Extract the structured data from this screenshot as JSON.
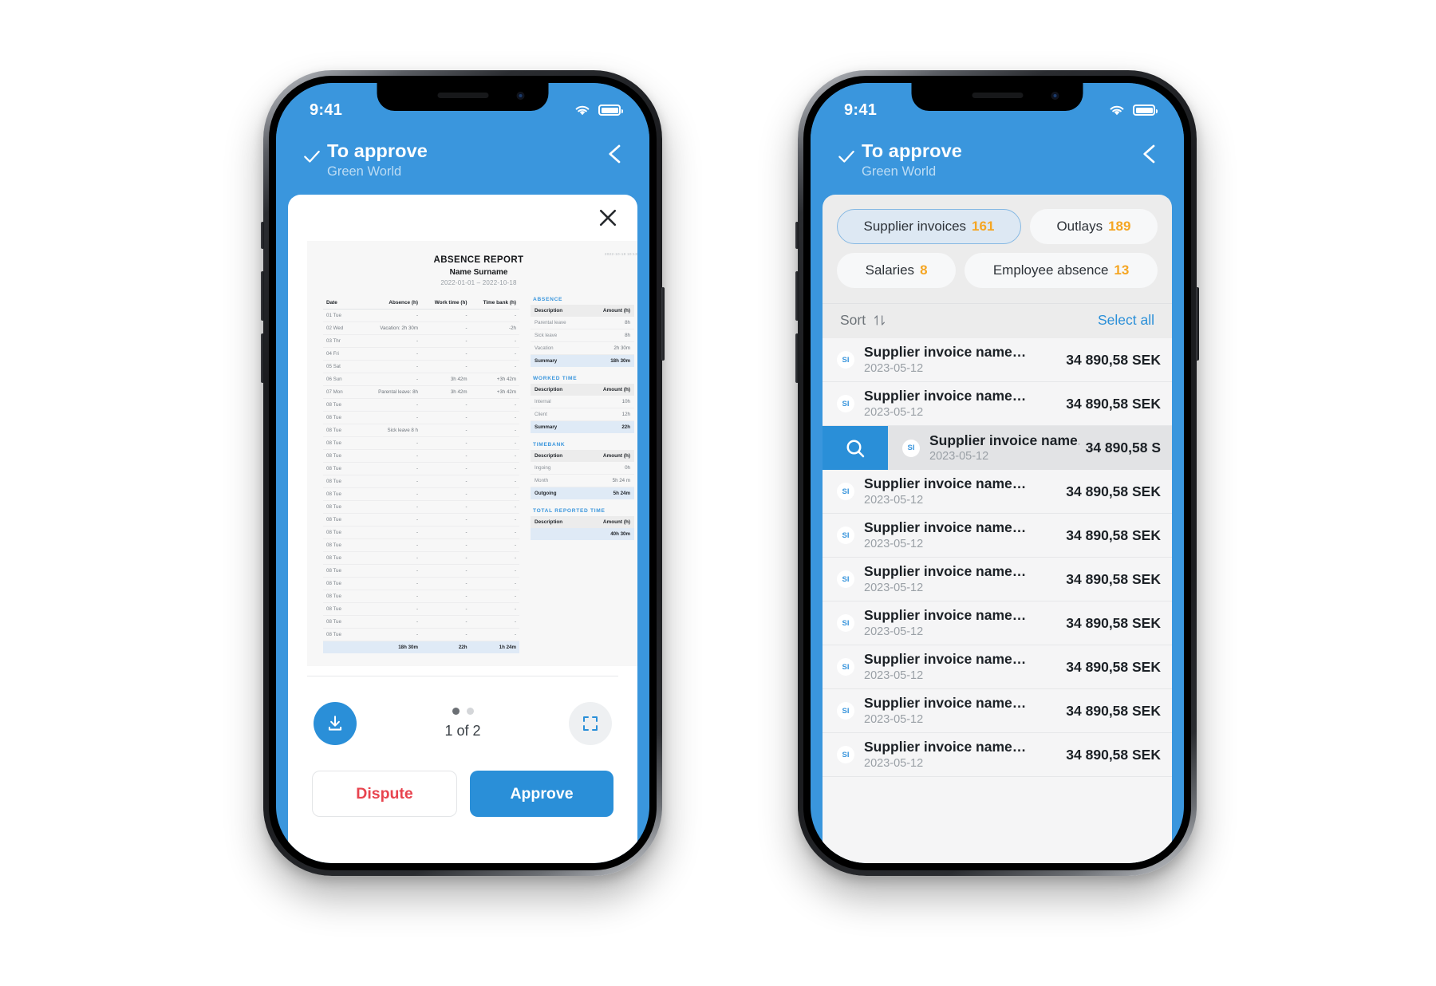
{
  "phones": {
    "left": {
      "status": {
        "time": "9:41",
        "wifi_icon": "wifi-icon",
        "battery_icon": "battery-icon"
      },
      "appbar": {
        "check_icon": "check-icon",
        "title": "To approve",
        "subtitle": "Green World",
        "back_icon": "chevron-left-icon"
      },
      "sheet": {
        "close_icon": "close-icon",
        "document": {
          "title": "ABSENCE REPORT",
          "person": "Name Surname",
          "date_range": "2022-01-01 – 2022-10-18",
          "corner_stamp": "2022-10-18 10:13",
          "main_table": {
            "headers": [
              "Date",
              "Absence (h)",
              "Work time (h)",
              "Time bank (h)"
            ],
            "rows": [
              [
                "01 Tue",
                "-",
                "-",
                "-"
              ],
              [
                "02 Wed",
                "Vacation: 2h 30m",
                "-",
                "-2h"
              ],
              [
                "03 Thr",
                "-",
                "-",
                "-"
              ],
              [
                "04 Fri",
                "-",
                "-",
                "-"
              ],
              [
                "05 Sat",
                "-",
                "-",
                "-"
              ],
              [
                "06 Sun",
                "-",
                "3h 42m",
                "+3h 42m"
              ],
              [
                "07 Mon",
                "Parental leave: 8h",
                "3h 42m",
                "+3h 42m"
              ],
              [
                "08 Tue",
                "-",
                "-",
                "-"
              ],
              [
                "08 Tue",
                "-",
                "-",
                "-"
              ],
              [
                "08 Tue",
                "Sick leave 8 h",
                "-",
                "-"
              ],
              [
                "08 Tue",
                "-",
                "-",
                "-"
              ],
              [
                "08 Tue",
                "-",
                "-",
                "-"
              ],
              [
                "08 Tue",
                "-",
                "-",
                "-"
              ],
              [
                "08 Tue",
                "-",
                "-",
                "-"
              ],
              [
                "08 Tue",
                "-",
                "-",
                "-"
              ],
              [
                "08 Tue",
                "-",
                "-",
                "-"
              ],
              [
                "08 Tue",
                "-",
                "-",
                "-"
              ],
              [
                "08 Tue",
                "-",
                "-",
                "-"
              ],
              [
                "08 Tue",
                "-",
                "-",
                "-"
              ],
              [
                "08 Tue",
                "-",
                "-",
                "-"
              ],
              [
                "08 Tue",
                "-",
                "-",
                "-"
              ],
              [
                "08 Tue",
                "-",
                "-",
                "-"
              ],
              [
                "08 Tue",
                "-",
                "-",
                "-"
              ],
              [
                "08 Tue",
                "-",
                "-",
                "-"
              ],
              [
                "08 Tue",
                "-",
                "-",
                "-"
              ],
              [
                "08 Tue",
                "-",
                "-",
                "-"
              ]
            ],
            "total_row": [
              "",
              "18h 30m",
              "22h",
              "1h 24m"
            ]
          },
          "sections": [
            {
              "label": "ABSENCE",
              "headers": [
                "Description",
                "Amount (h)"
              ],
              "rows": [
                [
                  "Parental leave",
                  "8h"
                ],
                [
                  "Sick leave",
                  "8h"
                ],
                [
                  "Vacation",
                  "2h 30m"
                ]
              ],
              "summary": [
                "Summary",
                "18h 30m"
              ]
            },
            {
              "label": "WORKED TIME",
              "headers": [
                "Description",
                "Amount (h)"
              ],
              "rows": [
                [
                  "Internal",
                  "10h"
                ],
                [
                  "Client",
                  "12h"
                ]
              ],
              "summary": [
                "Summary",
                "22h"
              ]
            },
            {
              "label": "TIMEBANK",
              "headers": [
                "Description",
                "Amount (h)"
              ],
              "rows": [
                [
                  "Ingoing",
                  "0h"
                ],
                [
                  "Month",
                  "5h 24 m"
                ]
              ],
              "summary": [
                "Outgoing",
                "5h 24m"
              ]
            },
            {
              "label": "TOTAL REPORTED TIME",
              "headers": [
                "Description",
                "Amount (h)"
              ],
              "rows": [],
              "summary": [
                "",
                "40h 30m"
              ]
            }
          ]
        },
        "pager": {
          "download_icon": "download-icon",
          "fullscreen_icon": "fullscreen-icon",
          "page_label": "1 of 2",
          "dots_total": 2,
          "dot_active": 1
        },
        "actions": {
          "dispute_label": "Dispute",
          "approve_label": "Approve"
        }
      }
    },
    "right": {
      "status": {
        "time": "9:41",
        "wifi_icon": "wifi-icon",
        "battery_icon": "battery-icon"
      },
      "appbar": {
        "check_icon": "check-icon",
        "title": "To approve",
        "subtitle": "Green World",
        "back_icon": "chevron-left-icon"
      },
      "tabs": [
        {
          "label": "Supplier invoices",
          "count": "161",
          "selected": true
        },
        {
          "label": "Outlays",
          "count": "189",
          "selected": false
        },
        {
          "label": "Salaries",
          "count": "8",
          "selected": false
        },
        {
          "label": "Employee absence",
          "count": "13",
          "selected": false
        }
      ],
      "toolbar": {
        "sort_label": "Sort",
        "sort_icon": "sort-arrows-icon",
        "select_all_label": "Select all"
      },
      "list": [
        {
          "badge": "SI",
          "title": "Supplier invoice name…",
          "date": "2023-05-12",
          "amount": "34 890,58 SEK",
          "active": false
        },
        {
          "badge": "SI",
          "title": "Supplier invoice name…",
          "date": "2023-05-12",
          "amount": "34 890,58 SEK",
          "active": false
        },
        {
          "badge": "SI",
          "title": "Supplier invoice name…",
          "date": "2023-05-12",
          "amount": "34 890,58 S",
          "active": true,
          "action_icon": "search-icon"
        },
        {
          "badge": "SI",
          "title": "Supplier invoice name…",
          "date": "2023-05-12",
          "amount": "34 890,58 SEK",
          "active": false
        },
        {
          "badge": "SI",
          "title": "Supplier invoice name…",
          "date": "2023-05-12",
          "amount": "34 890,58 SEK",
          "active": false
        },
        {
          "badge": "SI",
          "title": "Supplier invoice name…",
          "date": "2023-05-12",
          "amount": "34 890,58 SEK",
          "active": false
        },
        {
          "badge": "SI",
          "title": "Supplier invoice name…",
          "date": "2023-05-12",
          "amount": "34 890,58 SEK",
          "active": false
        },
        {
          "badge": "SI",
          "title": "Supplier invoice name…",
          "date": "2023-05-12",
          "amount": "34 890,58 SEK",
          "active": false
        },
        {
          "badge": "SI",
          "title": "Supplier invoice name…",
          "date": "2023-05-12",
          "amount": "34 890,58 SEK",
          "active": false
        },
        {
          "badge": "SI",
          "title": "Supplier invoice name…",
          "date": "2023-05-12",
          "amount": "34 890,58 SEK",
          "active": false
        }
      ]
    }
  },
  "colors": {
    "brand_blue": "#3a96dd",
    "accent_orange": "#f5a623",
    "danger_red": "#e8444f",
    "screen_bg": "#ececec"
  }
}
